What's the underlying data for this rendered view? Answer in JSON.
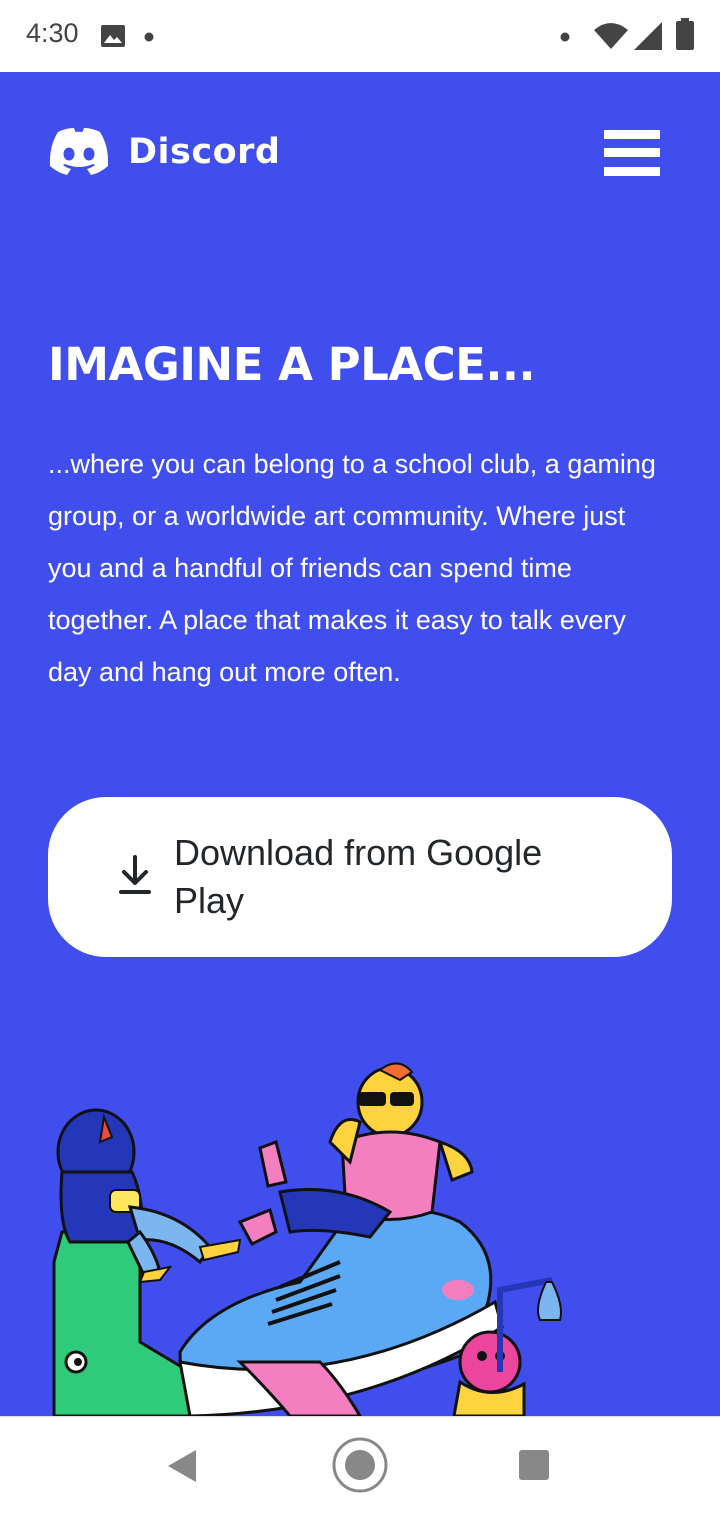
{
  "status_bar": {
    "time": "4:30",
    "icons": [
      "image-icon",
      "notification-dot-icon",
      "dot-icon",
      "wifi-icon",
      "signal-icon",
      "battery-icon"
    ]
  },
  "header": {
    "brand": "Discord",
    "logo_icon": "discord-logo-icon",
    "menu_icon": "hamburger-menu-icon"
  },
  "hero": {
    "headline": "IMAGINE A PLACE...",
    "description": "...where you can belong to a school club, a gaming group, or a worldwide art community. Where just you and a handful of friends can spend time together. A place that makes it easy to talk every day and hang out more often.",
    "download_label": "Download from Google Play",
    "download_icon": "download-icon",
    "background_color": "#404EED"
  },
  "nav_bar": {
    "back_icon": "back-triangle-icon",
    "home_icon": "home-circle-icon",
    "recents_icon": "recents-square-icon"
  }
}
